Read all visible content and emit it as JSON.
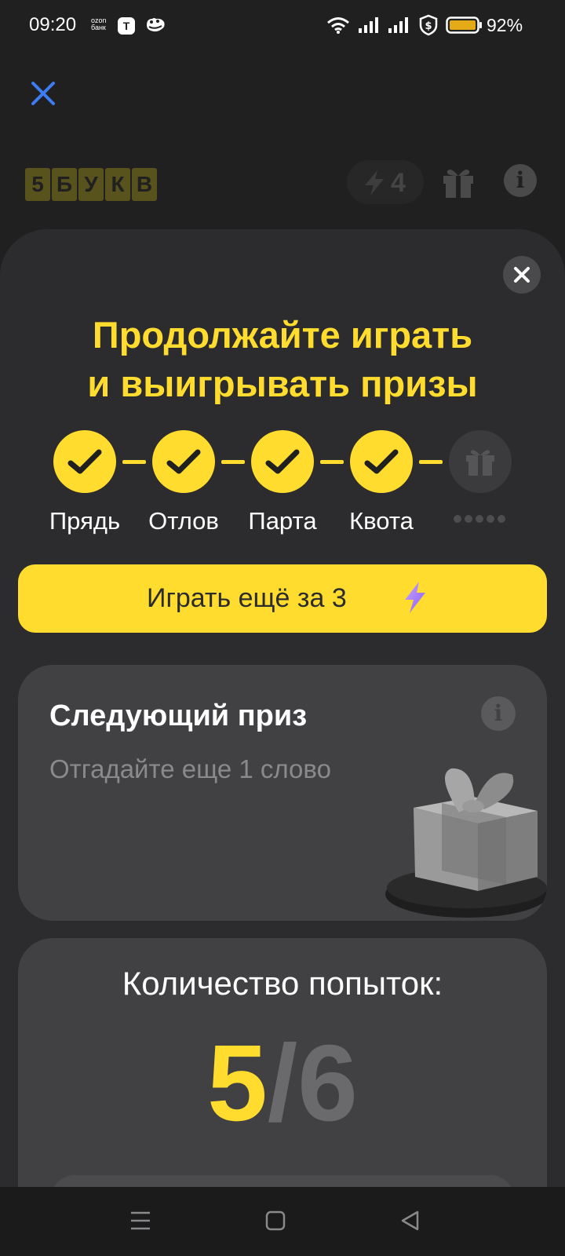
{
  "status_bar": {
    "time": "09:20",
    "ozon_line1": "ozon",
    "ozon_line2": "банк",
    "app_badge": "T",
    "battery": "92%",
    "icons": [
      "wifi-icon",
      "signal-icon",
      "signal-icon",
      "vpn-shield-icon",
      "battery-icon"
    ]
  },
  "header": {
    "logo_letters": [
      "5",
      "Б",
      "У",
      "К",
      "В"
    ],
    "energy_count": "4"
  },
  "sheet": {
    "title_line1": "Продолжайте играть",
    "title_line2": "и выигрывать призы",
    "steps": [
      {
        "label": "Прядь",
        "done": true
      },
      {
        "label": "Отлов",
        "done": true
      },
      {
        "label": "Парта",
        "done": true
      },
      {
        "label": "Квота",
        "done": true
      }
    ],
    "play_button": "Играть ещё за 3",
    "prize": {
      "title": "Следующий приз",
      "subtitle": "Отгадайте еще 1 слово"
    },
    "attempts": {
      "title": "Количество попыток:",
      "current": "5",
      "separator": "/",
      "max": "6"
    }
  },
  "colors": {
    "accent": "#ffdc2d",
    "background": "#202021",
    "sheet": "#2c2c2e",
    "card": "#414143"
  }
}
